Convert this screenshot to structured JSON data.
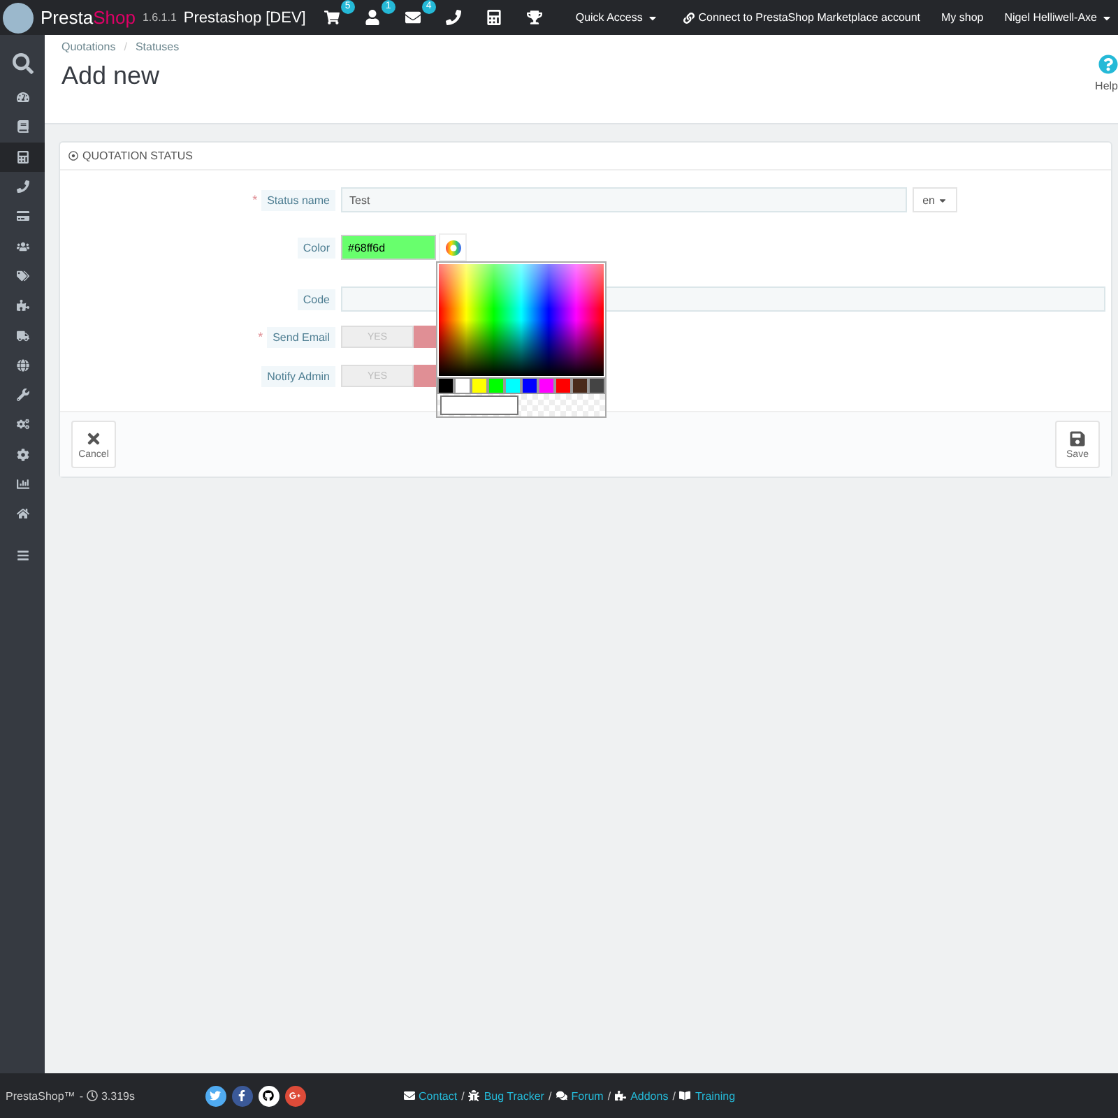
{
  "topbar": {
    "brand_a": "Presta",
    "brand_b": "Shop",
    "version": "1.6.1.1",
    "shop_name": "Prestashop [DEV]",
    "notifications": [
      {
        "kind": "cart",
        "count": "5"
      },
      {
        "kind": "user",
        "count": "1"
      },
      {
        "kind": "mail",
        "count": "4"
      },
      {
        "kind": "phone"
      },
      {
        "kind": "calculator"
      },
      {
        "kind": "trophy"
      }
    ],
    "quick_access": "Quick Access",
    "marketplace": "Connect to PrestaShop Marketplace account",
    "my_shop": "My shop",
    "user": "Nigel Helliwell-Axe"
  },
  "sidebar": {
    "items": [
      {
        "kind": "search",
        "selected": false
      },
      {
        "kind": "dashboard",
        "selected": false
      },
      {
        "kind": "book",
        "selected": false
      },
      {
        "kind": "calculator",
        "selected": true
      },
      {
        "kind": "phone",
        "selected": false
      },
      {
        "kind": "card",
        "selected": false
      },
      {
        "kind": "users",
        "selected": false
      },
      {
        "kind": "tags",
        "selected": false
      },
      {
        "kind": "puzzle",
        "selected": false
      },
      {
        "kind": "truck",
        "selected": false
      },
      {
        "kind": "globe",
        "selected": false
      },
      {
        "kind": "wrench",
        "selected": false
      },
      {
        "kind": "cogs",
        "selected": false
      },
      {
        "kind": "cog",
        "selected": false
      },
      {
        "kind": "chart",
        "selected": false
      },
      {
        "kind": "home",
        "selected": false
      },
      {
        "kind": "menu",
        "selected": false
      }
    ]
  },
  "breadcrumb": [
    "Quotations",
    "Statuses"
  ],
  "breadcrumb_separator": "/",
  "title": "Add new",
  "help": "Help",
  "panel": {
    "heading": "QUOTATION STATUS",
    "fields": [
      {
        "kind": "text",
        "label": "Status name",
        "required": true,
        "value": "Test",
        "language": "en"
      },
      {
        "kind": "color",
        "label": "Color",
        "required": false,
        "value": "#68ff6d",
        "color": "#68ff6d"
      },
      {
        "kind": "text",
        "label": "Code",
        "required": false
      },
      {
        "kind": "switch",
        "label": "Send Email",
        "required": true,
        "yes": "YES",
        "on": false
      },
      {
        "kind": "switch",
        "label": "Notify Admin",
        "required": false,
        "yes": "YES",
        "on": false
      }
    ],
    "required_mark": "*",
    "cancel": "Cancel",
    "save": "Save"
  },
  "color_picker": {
    "palette": [
      {
        "color": "#000000"
      },
      {
        "color": "#ffffff"
      },
      {
        "color": "#ffff00"
      },
      {
        "color": "#00ff00"
      },
      {
        "color": "#00ffff"
      },
      {
        "color": "#0000ff"
      },
      {
        "color": "#ff00ff"
      },
      {
        "color": "#ff0000"
      },
      {
        "color": "#4a2a1a"
      },
      {
        "color": "#444444"
      }
    ]
  },
  "footer": {
    "brand": "PrestaShop™",
    "dash": "-",
    "time": "3.319s",
    "separator": "/",
    "social": [
      {
        "kind": "twitter",
        "color": "#50abf1"
      },
      {
        "kind": "facebook",
        "color": "#3b5998"
      },
      {
        "kind": "github",
        "color": "#ffffff"
      },
      {
        "kind": "google",
        "color": "#dd4b39"
      }
    ],
    "links": [
      {
        "kind": "contact",
        "label": "Contact"
      },
      {
        "kind": "bug",
        "label": "Bug Tracker"
      },
      {
        "kind": "forum",
        "label": "Forum"
      },
      {
        "kind": "addons",
        "label": "Addons"
      },
      {
        "kind": "training",
        "label": "Training"
      }
    ]
  }
}
